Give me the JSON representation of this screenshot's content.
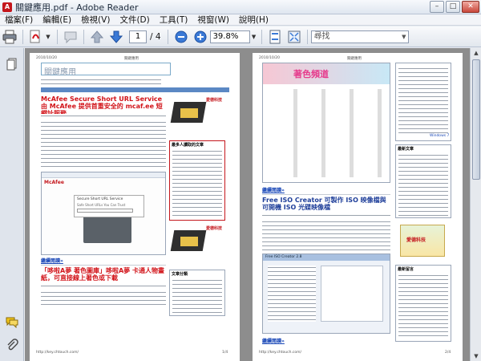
{
  "window": {
    "title": "關鍵應用.pdf - Adobe Reader",
    "app_icon_glyph": "A",
    "controls": {
      "minimize": "–",
      "maximize": "□",
      "close": "✕"
    }
  },
  "menu": [
    {
      "id": "file",
      "label": "檔案(F)"
    },
    {
      "id": "edit",
      "label": "編輯(E)"
    },
    {
      "id": "view",
      "label": "檢視(V)"
    },
    {
      "id": "document",
      "label": "文件(D)"
    },
    {
      "id": "tools",
      "label": "工具(T)"
    },
    {
      "id": "window",
      "label": "視窗(W)"
    },
    {
      "id": "help",
      "label": "說明(H)"
    }
  ],
  "toolbar": {
    "icons": [
      "print-icon",
      "create-pdf-icon",
      "comment-icon",
      "previous-page-icon",
      "next-page-icon",
      "zoom-out-icon",
      "zoom-in-icon",
      "fit-page-icon",
      "full-screen-icon"
    ],
    "current_page": "1",
    "total_pages": "/ 4",
    "zoom": "39.8%",
    "search_placeholder": "尋找"
  },
  "nav_pane": {
    "icons": [
      "pages-icon",
      "comments-icon",
      "attachments-icon"
    ]
  },
  "colors": {
    "accent_red": "#d2141a",
    "link_blue": "#1b49b8",
    "doc_background": "#8d8d8d"
  },
  "pages": [
    {
      "date": "2010/10/20",
      "header": "關鍵應用",
      "site_title": "關鍵應用",
      "headline1": "McAfee Secure Short URL Service 由 McAfee 提供首重安全的 mcaf.ee 短網址服務",
      "continue1": "繼續閱讀»",
      "headline2": "「哆啦A夢 著色圖庫」哆啦A夢 卡通人物畫紙，可直接線上著色或下載",
      "continue2": "繼續閱讀»",
      "shot_title": "McAfee",
      "shot_url": "Secure Short URL Service",
      "shot_tagline": "Safe Short URLs You Can Trust",
      "sidebar_title": "最多人讀取的文章",
      "sidebar2_title": "文章分類",
      "brand": "愛德科技",
      "footer_url": "http://key.chtouch.com/",
      "footer_page": "1/4"
    },
    {
      "date": "2010/10/20",
      "header": "關鍵應用",
      "banner": "著色頻道",
      "continue0": "繼續閱讀»",
      "headline1": "Free ISO Creator 可製作 ISO 映像檔與可開機 ISO 光碟映像檔",
      "continue1": "繼續閱讀»",
      "dialog_title": "Free ISO Creator 2.8",
      "right_label": "Windows 7",
      "sidebar_title": "最新文章",
      "sidebar2_title": "最新留言",
      "brand": "愛德科技",
      "footer_url": "http://key.chtouch.com/",
      "footer_page": "2/4"
    }
  ]
}
